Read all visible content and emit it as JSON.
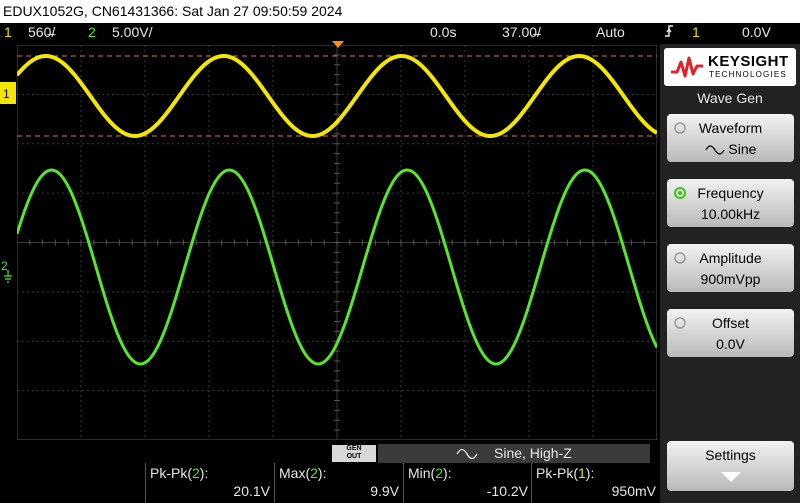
{
  "title_bar": {
    "text": "EDUX1052G, CN61431366: Sat Jan 27 09:50:59 2024"
  },
  "status_bar": {
    "ch1_num": "1",
    "ch1_scale": "560̶/",
    "ch2_num": "2",
    "ch2_scale": "5.00V/",
    "time_delay": "0.0s",
    "time_scale": "37.00̶/",
    "trigger_mode": "Auto",
    "trigger_source": "1",
    "trigger_level": "0.0V",
    "trigger_icon": "rising-edge-trigger-icon"
  },
  "waveforms": {
    "ch1": {
      "label": "1",
      "color": "#f3e600",
      "cycles": 3.6,
      "amplitude_fraction": 0.5,
      "shape": "sine"
    },
    "ch2": {
      "label": "2",
      "color": "#58e62a",
      "cycles": 3.6,
      "amplitude_fraction": 0.5,
      "shape": "sine"
    }
  },
  "side_panel": {
    "logo_name": "KEYSIGHT",
    "logo_sub": "TECHNOLOGIES",
    "menu_title": "Wave Gen",
    "softkeys": [
      {
        "label": "Waveform",
        "value": "Sine",
        "active": false
      },
      {
        "label": "Frequency",
        "value": "10.00kHz",
        "active": true
      },
      {
        "label": "Amplitude",
        "value": "900mVpp",
        "active": false
      },
      {
        "label": "Offset",
        "value": "0.0V",
        "active": false
      }
    ],
    "settings_label": "Settings"
  },
  "gen_bar": {
    "badge_line1": "GEN",
    "badge_line2": "OUT",
    "text": "Sine, High-Z"
  },
  "measurements": [
    {
      "label": "Pk-Pk(",
      "chan": "2",
      "close": "):",
      "value": "20.1V"
    },
    {
      "label": "Max(",
      "chan": "2",
      "close": "):",
      "value": "9.9V"
    },
    {
      "label": "Min(",
      "chan": "2",
      "close": "):",
      "value": "-10.2V"
    },
    {
      "label": "Pk-Pk(",
      "chan": "1",
      "close": "):",
      "value": "950mV"
    }
  ],
  "colors": {
    "ch1": "#f3e600",
    "ch2": "#58e62a",
    "trigger_marker": "#ff8c1a",
    "cursor_line": "#e07060"
  }
}
